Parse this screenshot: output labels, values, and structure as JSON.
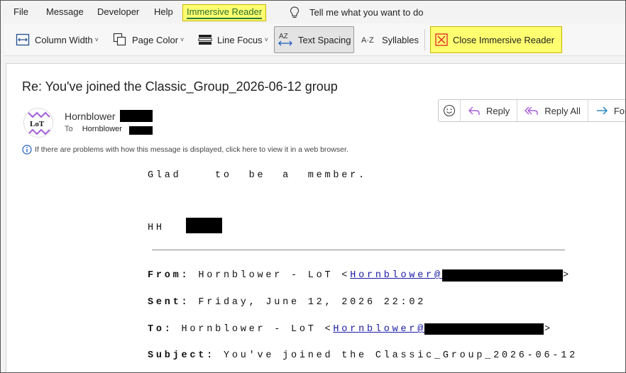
{
  "menu": {
    "file": "File",
    "message": "Message",
    "developer": "Developer",
    "help": "Help",
    "immersive_reader": "Immersive Reader",
    "tell_me": "Tell me what you want to do"
  },
  "ribbon": {
    "column_width": "Column Width",
    "page_color": "Page Color",
    "line_focus": "Line Focus",
    "text_spacing": "Text Spacing",
    "syllables": "Syllables",
    "close_immersive_reader": "Close Immersive Reader"
  },
  "message": {
    "subject": "Re: You've joined the Classic_Group_2026-06-12 group",
    "sender_name": "Hornblower",
    "to_label": "To",
    "to_name": "Hornblower",
    "avatar_text": "LoT",
    "info": "If there are problems with how this message is displayed, click here to view it in a web browser."
  },
  "actions": {
    "reply": "Reply",
    "reply_all": "Reply All",
    "forward": "Forw"
  },
  "body": {
    "line1": "Glad    to  be  a  member.",
    "sig": "HH",
    "from_label": "From:",
    "from_value": "Hornblower - LoT <",
    "from_email": "Hornblower@",
    "from_close": ">",
    "sent_label": "Sent:",
    "sent_value": "Friday, June 12, 2026 22:02",
    "to_label": "To:",
    "to_value": "Hornblower - LoT <",
    "to_email": "Hornblower@",
    "to_close": ">",
    "subject_label": "Subject:",
    "subject_value": "You've joined the Classic_Group_2026-06-12"
  },
  "colors": {
    "highlight": "#ffff70",
    "link": "#1a1aa6",
    "accent": "#2a6f2a"
  }
}
